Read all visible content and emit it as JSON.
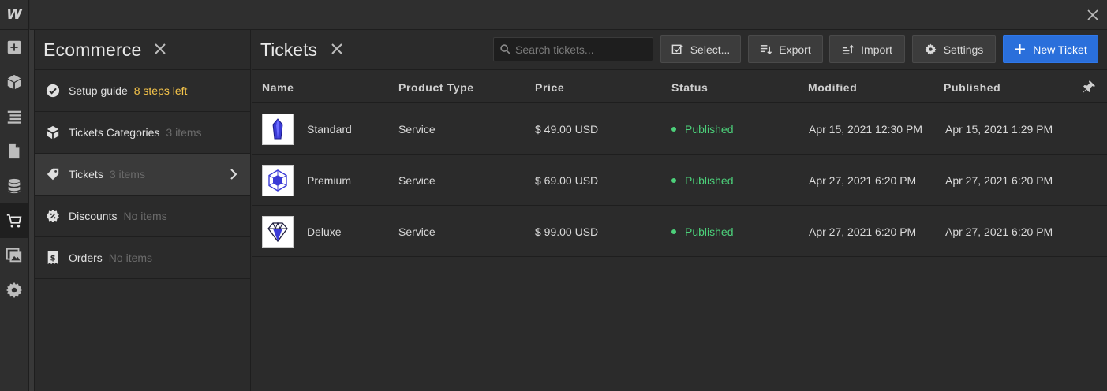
{
  "app": {
    "logo_letter": "W"
  },
  "rail": {
    "items": [
      {
        "icon": "plus-square-icon"
      },
      {
        "icon": "cube-icon"
      },
      {
        "icon": "navigator-icon"
      },
      {
        "icon": "pages-icon"
      },
      {
        "icon": "cms-database-icon"
      },
      {
        "icon": "ecommerce-cart-icon",
        "active": true
      },
      {
        "icon": "assets-icon"
      },
      {
        "icon": "settings-gear-icon"
      }
    ]
  },
  "panel": {
    "title": "Ecommerce",
    "items": [
      {
        "label": "Setup guide",
        "count": "8 steps left",
        "icon": "check-circle-icon"
      },
      {
        "label": "Tickets Categories",
        "count": "3 items",
        "icon": "category-icon"
      },
      {
        "label": "Tickets",
        "count": "3 items",
        "icon": "tag-icon",
        "selected": true
      },
      {
        "label": "Discounts",
        "count": "No items",
        "icon": "discount-badge-icon"
      },
      {
        "label": "Orders",
        "count": "No items",
        "icon": "receipt-icon"
      }
    ]
  },
  "main": {
    "title": "Tickets",
    "search_placeholder": "Search tickets...",
    "buttons": {
      "select": "Select...",
      "export": "Export",
      "import": "Import",
      "settings": "Settings",
      "new_ticket": "New Ticket"
    },
    "columns": [
      "Name",
      "Product Type",
      "Price",
      "Status",
      "Modified",
      "Published"
    ],
    "rows": [
      {
        "name": "Standard",
        "type": "Service",
        "price": "$ 49.00 USD",
        "status": "Published",
        "modified": "Apr 15, 2021 12:30 PM",
        "published": "Apr 15, 2021 1:29 PM",
        "thumb": "crystal-icon"
      },
      {
        "name": "Premium",
        "type": "Service",
        "price": "$ 69.00 USD",
        "status": "Published",
        "modified": "Apr 27, 2021 6:20 PM",
        "published": "Apr 27, 2021 6:20 PM",
        "thumb": "hexagon-gem-icon"
      },
      {
        "name": "Deluxe",
        "type": "Service",
        "price": "$ 99.00 USD",
        "status": "Published",
        "modified": "Apr 27, 2021 6:20 PM",
        "published": "Apr 27, 2021 6:20 PM",
        "thumb": "diamond-icon"
      }
    ]
  },
  "colors": {
    "accent": "#2a6fdb",
    "published": "#4cd07a",
    "warning": "#f5c44a",
    "gem": "#3b3bd6"
  }
}
